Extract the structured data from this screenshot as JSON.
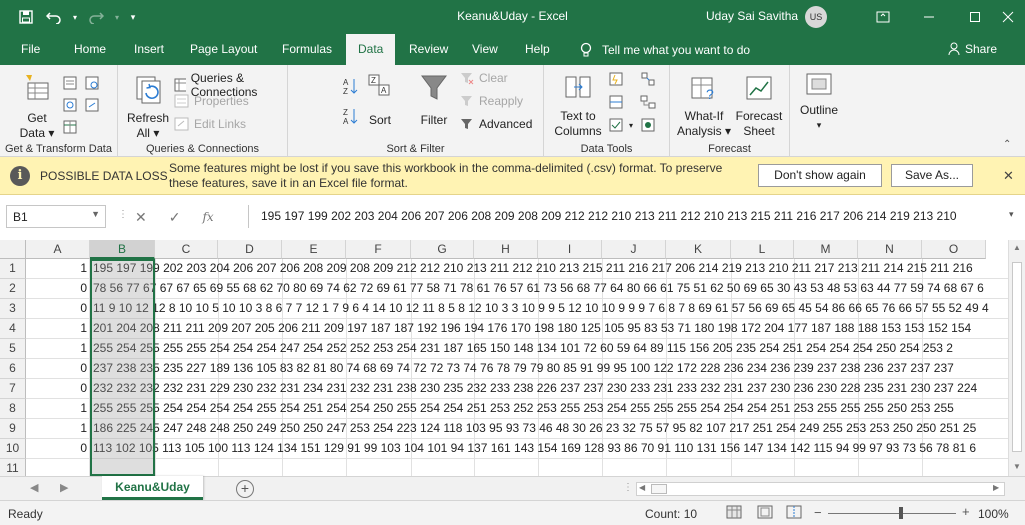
{
  "titlebar": {
    "title": "Keanu&Uday  -  Excel",
    "user": "Uday Sai Savitha",
    "initials": "US"
  },
  "tabs": [
    "File",
    "Home",
    "Insert",
    "Page Layout",
    "Formulas",
    "Data",
    "Review",
    "View",
    "Help"
  ],
  "active_tab": "Data",
  "tellme": "Tell me what you want to do",
  "share": "Share",
  "ribbon": {
    "get_transform": {
      "get_data_l1": "Get",
      "get_data_l2": "Data",
      "label": "Get & Transform Data"
    },
    "queries": {
      "refresh_l1": "Refresh",
      "refresh_l2": "All",
      "qc": "Queries & Connections",
      "properties": "Properties",
      "edit_links": "Edit Links",
      "label": "Queries & Connections"
    },
    "sort_filter": {
      "sort": "Sort",
      "filter": "Filter",
      "clear": "Clear",
      "reapply": "Reapply",
      "advanced": "Advanced",
      "label": "Sort & Filter"
    },
    "data_tools": {
      "ttc_l1": "Text to",
      "ttc_l2": "Columns",
      "label": "Data Tools"
    },
    "forecast": {
      "whatif_l1": "What-If",
      "whatif_l2": "Analysis",
      "fsheet_l1": "Forecast",
      "fsheet_l2": "Sheet",
      "label": "Forecast"
    },
    "outline": {
      "label": "Outline"
    }
  },
  "infobar": {
    "title": "POSSIBLE DATA LOSS",
    "message": "Some features might be lost if you save this workbook in the comma-delimited (.csv) format. To preserve these features, save it in an Excel file format.",
    "dont_show": "Don't show again",
    "save_as": "Save As..."
  },
  "formula_bar": {
    "name_box": "B1",
    "fx": "fx",
    "content": "195 197 199 202 203 204 206 207 206 208 209 208 209 212 212 210 213 211 212 210 213 215 211 216 217 206 214 219 213 210"
  },
  "columns": [
    "A",
    "B",
    "C",
    "D",
    "E",
    "F",
    "G",
    "H",
    "I",
    "J",
    "K",
    "L",
    "M",
    "N",
    "O"
  ],
  "rows": [
    {
      "n": "1",
      "a": "1",
      "b": "195 197 199 202 203 204 206 207 206 208 209 208 209 212 212 210 213 211 212 210 213 215 211 216 217 206 214 219 213 210 211 217 213 211 214 215 211 216"
    },
    {
      "n": "2",
      "a": "0",
      "b": "78 56 77 67 67 67 65 69 55 68 62 70 80 69 74 62 72 69 61 77 58 71 78 61 76 57 61 73 56 68 77 64 80 66 61 75 51 62 50 69 65 30 43 53 48 53 63 44 77 59 74 68 67 6"
    },
    {
      "n": "3",
      "a": "0",
      "b": "11 9 10 12 12 8 10 10 5 10 10 3 8 6 7 7 12 1 7 9 6 4 14 10 12 11 8 5 8 12 10 3 3 10 9 9 5 12 10 10 9 9 9 7 6 8 7 8 69 61 57 56 69 65 45 54 86 66 65 76 66 57 55 52 49 4"
    },
    {
      "n": "4",
      "a": "1",
      "b": "201 204 208 211 211 209 207 205 206 211 209 197 187 187 192 196 194 176 170 198 180 125 105 95 83 53 71 180 198 172 204 177 187 188 188 153 153 152 154"
    },
    {
      "n": "5",
      "a": "1",
      "b": "255 254 255 255 255 254 254 254 247 254 252 252 253 254 231 187 165 150 148 134 101 72 60 59 64 89 115 156 205 235 254 251 254 254 254 250 254 253 2"
    },
    {
      "n": "6",
      "a": "0",
      "b": "237 238 235 235 227 189 136 105 83 82 81 80 74 68 69 74 72 72 73 74 76 78 79 79 80 85 91 99 95 100 122 172 228 236 234 236 239 237 238 236 237 237 237"
    },
    {
      "n": "7",
      "a": "0",
      "b": "232 232 232 232 231 229 230 232 231 234 231 232 231 238 230 235 232 233 238 226 237 237 230 233 231 233 232 231 237 230 236 230 228 235 231 230 237 224"
    },
    {
      "n": "8",
      "a": "1",
      "b": "255 255 255 254 254 254 254 255 254 251 254 254 250 255 254 254 251 253 252 253 255 253 254 255 255 255 254 254 254 251 253 255 255 255 250 253 255"
    },
    {
      "n": "9",
      "a": "1",
      "b": "186 225 245 247 248 248 250 249 250 250 247 253 254 223 124 118 103 95 93 73 46 48 30 26 23 32 75 57 95 82 107 217 251 254 249 255 253 253 250 250 251 25"
    },
    {
      "n": "10",
      "a": "0",
      "b": "113 102 105 113 105 100 113 124 134 151 129 91 99 103 104 101 94 137 161 143 154 169 128 93 86 70 91 110 131 156 147 134 142 115 94 99 97 93 73 56 78 81 6"
    },
    {
      "n": "11",
      "a": "",
      "b": ""
    }
  ],
  "sheet_tab": "Keanu&Uday",
  "status": {
    "ready": "Ready",
    "count": "Count: 10",
    "zoom": "100%"
  }
}
